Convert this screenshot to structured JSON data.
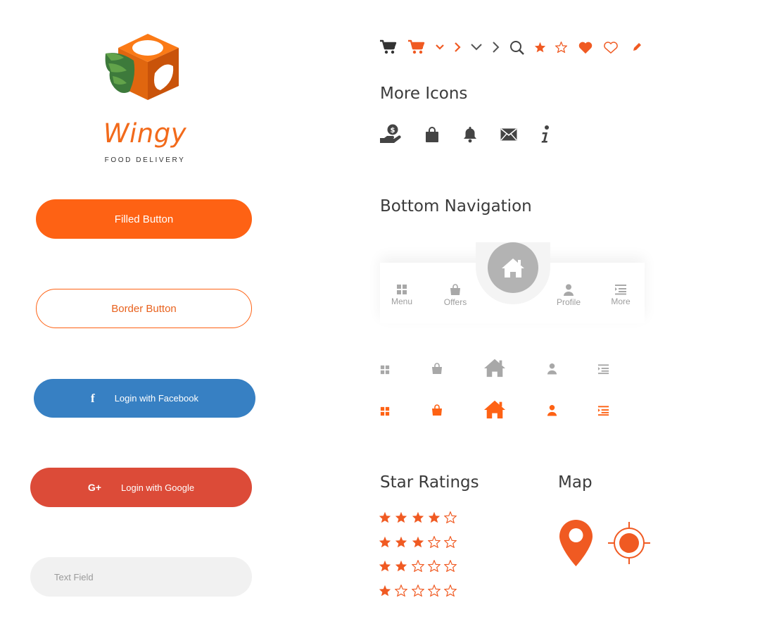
{
  "brand": {
    "name": "Wingy",
    "tagline": "FOOD DELIVERY",
    "logo_icon": "winged-box-logo-icon",
    "accent_color": "#fe6214"
  },
  "buttons": {
    "filled_label": "Filled Button",
    "border_label": "Border Button",
    "facebook_label": "Login with Facebook",
    "facebook_glyph": "f",
    "google_label": "Login with Google",
    "google_glyph": "G+"
  },
  "text_field": {
    "placeholder": "Text Field"
  },
  "top_icons": [
    "cart-icon-dark",
    "cart-icon-orange",
    "chevron-down-icon-orange",
    "chevron-right-icon-orange",
    "chevron-down-icon-gray",
    "chevron-right-icon-gray",
    "search-icon",
    "star-filled-icon",
    "star-outline-icon",
    "heart-filled-icon",
    "heart-outline-icon",
    "pencil-icon"
  ],
  "more_icons": {
    "title": "More Icons",
    "items": [
      "hand-coin-icon",
      "shopping-bag-icon",
      "bell-icon",
      "mail-icon",
      "info-icon"
    ]
  },
  "bottom_navigation": {
    "title": "Bottom Navigation",
    "items": [
      {
        "label": "Menu",
        "icon": "grid-icon"
      },
      {
        "label": "Offers",
        "icon": "bag-icon"
      },
      {
        "label": "Home",
        "icon": "home-icon"
      },
      {
        "label": "Profile",
        "icon": "user-icon"
      },
      {
        "label": "More",
        "icon": "list-icon"
      }
    ],
    "inactive_color": "#b3b3b3",
    "active_color": "#fe6214"
  },
  "star_ratings": {
    "title": "Star Ratings",
    "max": 5,
    "ratings": [
      4,
      3,
      2,
      1
    ],
    "color": "#f05a22"
  },
  "map": {
    "title": "Map",
    "icons": [
      "map-pin-icon",
      "crosshair-location-icon"
    ]
  }
}
